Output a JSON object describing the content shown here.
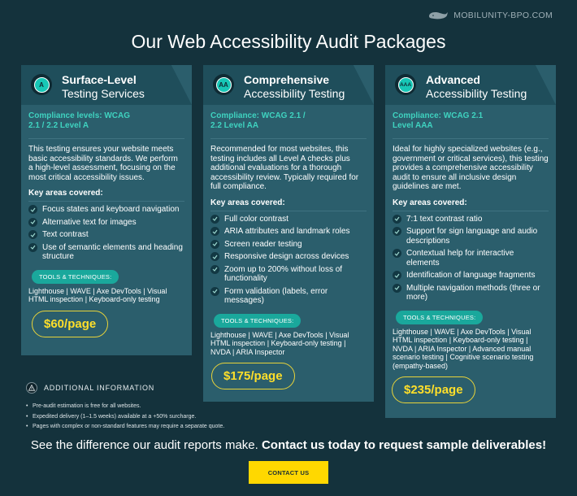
{
  "brand": {
    "name": "MOBILUNITY-BPO.COM",
    "icon": "whale-icon"
  },
  "title": "Our Web Accessibility Audit Packages",
  "colors": {
    "background": "#14323c",
    "card": "#2b5e6c",
    "accent_teal": "#3fd3c0",
    "price_yellow": "#ffdf2a",
    "cta_yellow": "#ffd800"
  },
  "packages": [
    {
      "badge": "A",
      "title": "Surface-Level",
      "subtitle": "Testing Services",
      "compliance": "Compliance levels: WCAG 2.1 / 2.2 Level A",
      "description": "This testing ensures your website meets basic accessibility standards. We perform a high-level assessment, focusing on the most critical accessibility issues.",
      "key_title": "Key areas covered:",
      "items": [
        "Focus states and keyboard navigation",
        "Alternative text for images",
        "Text contrast",
        "Use of semantic elements and heading structure"
      ],
      "tools_label": "TOOLS & TECHNIQUES:",
      "tools": "Lighthouse | WAVE | Axe DevTools | Visual HTML inspection | Keyboard-only testing",
      "price": "$60/page"
    },
    {
      "badge": "AA",
      "title": "Comprehensive",
      "subtitle": "Accessibility Testing",
      "compliance": "Compliance: WCAG 2.1 / 2.2 Level AA",
      "description": "Recommended for most websites, this testing includes all Level A checks plus additional evaluations for a thorough accessibility review. Typically required for full compliance.",
      "key_title": "Key areas covered:",
      "items": [
        "Full color contrast",
        "ARIA attributes and landmark roles",
        "Screen reader testing",
        "Responsive design across devices",
        "Zoom up to 200% without loss of functionality",
        "Form validation (labels, error messages)"
      ],
      "tools_label": "TOOLS & TECHNIQUES:",
      "tools": "Lighthouse | WAVE | Axe DevTools | Visual HTML inspection | Keyboard-only testing | NVDA | ARIA Inspector",
      "price": "$175/page"
    },
    {
      "badge": "AAA",
      "title": "Advanced",
      "subtitle": "Accessibility Testing",
      "compliance": "Compliance: WCAG 2.1 Level AAA",
      "description": "Ideal for highly specialized websites (e.g., government or critical services), this testing provides a comprehensive accessibility audit to ensure all inclusive design guidelines are met.",
      "key_title": "Key areas covered:",
      "items": [
        "7:1 text contrast ratio",
        "Support for sign language and audio descriptions",
        "Contextual help for interactive elements",
        "Identification of language fragments",
        "Multiple navigation methods (three or more)"
      ],
      "tools_label": "TOOLS & TECHNIQUES:",
      "tools": "Lighthouse | WAVE | Axe DevTools | Visual HTML inspection | Keyboard-only testing | NVDA | ARIA Inspector | Advanced manual scenario testing | Cognitive scenario testing (empathy-based)",
      "price": "$235/page"
    }
  ],
  "additional": {
    "heading": "ADDITIONAL INFORMATION",
    "items": [
      "Pre-audit estimation is free for all websites.",
      "Expedited delivery (1–1.5 weeks) available at a +50% surcharge.",
      "Pages with complex or non-standard features may require a separate quote."
    ]
  },
  "cta": {
    "text": "See the difference our audit reports make.",
    "bold": "Contact us today to request sample deliverables!",
    "button": "CONTACT US"
  }
}
